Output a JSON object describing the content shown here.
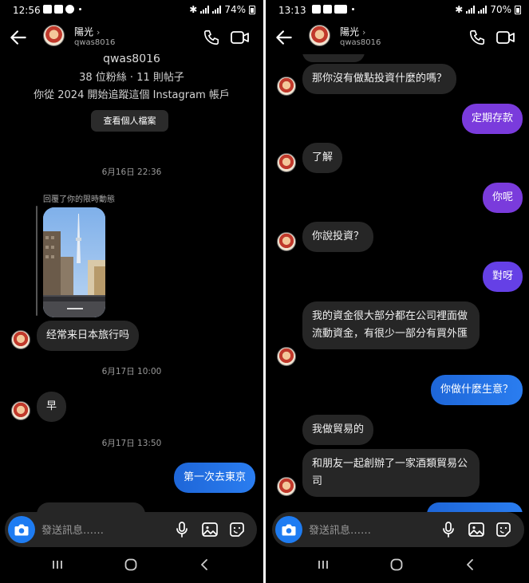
{
  "left": {
    "status": {
      "time": "12:56",
      "battery": "74%"
    },
    "header": {
      "name": "陽光",
      "username": "qwas8016"
    },
    "profile": {
      "username": "qwas8016",
      "stats": "38 位粉絲 · 11 則帖子",
      "since": "你從 2024 開始追蹤這個 Instagram 帳戶",
      "view_button": "查看個人檔案"
    },
    "messages": {
      "ts1": "6月16日 22:36",
      "story_reply_label": "回覆了你的限時動態",
      "m1": "经常来日本旅行吗",
      "ts2": "6月17日 10:00",
      "m2": "早",
      "ts3": "6月17日 13:50",
      "m3": "第一次去東京"
    },
    "composer": {
      "placeholder": "發送訊息……"
    }
  },
  "right": {
    "status": {
      "time": "13:13",
      "battery": "70%"
    },
    "header": {
      "name": "陽光",
      "username": "qwas8016"
    },
    "messages": {
      "r1": "那你沒有做點投資什麼的嗎？",
      "r2": "定期存款",
      "r3": "了解",
      "r4": "你呢",
      "r5": "你說投資？",
      "r6": "對呀",
      "r7": "我的資金很大部分都在公司裡面做流動資金，有很少一部分有買外匯",
      "r8": "你做什麼生意？",
      "r9": "我做貿易的",
      "r10": "和朋友一起創辦了一家酒類貿易公司"
    },
    "composer": {
      "placeholder": "發送訊息……"
    }
  },
  "icons": [
    "back-arrow-icon",
    "phone-icon",
    "video-icon",
    "camera-icon",
    "microphone-icon",
    "image-icon",
    "sticker-icon",
    "recents-icon",
    "home-icon",
    "back-nav-icon"
  ],
  "colors": {
    "background": "#000000",
    "incoming_bubble": "#262626",
    "outgoing_bubble": "#2a7df0",
    "outgoing_purple": "#7a3bdc",
    "camera_button": "#1e7cf2"
  }
}
